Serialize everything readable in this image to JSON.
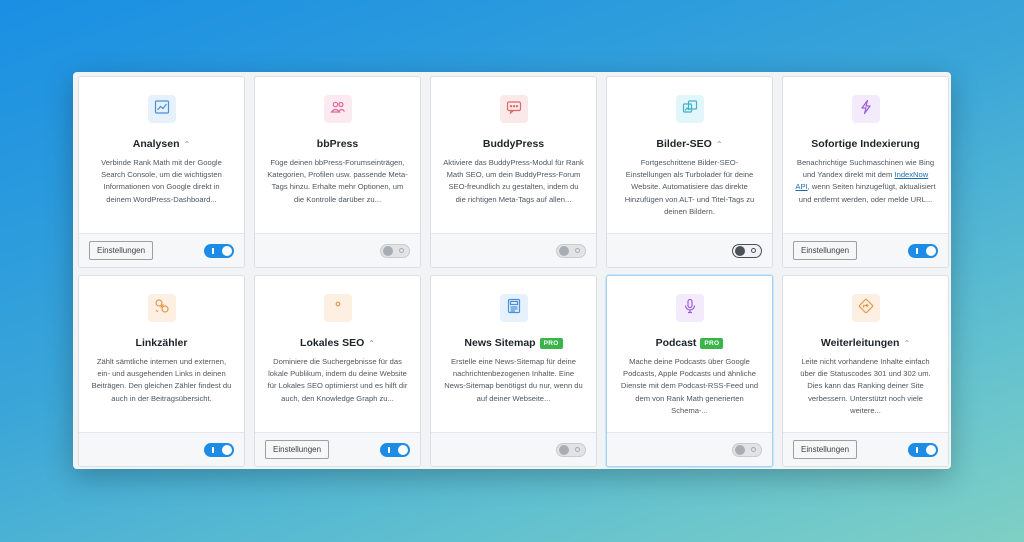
{
  "settings_label": "Einstellungen",
  "pro_label": "PRO",
  "modules": [
    {
      "title": "Analysen",
      "collapsible": true,
      "pro": false,
      "icon": "chart-icon",
      "icon_bg": "#e7f1fb",
      "icon_color": "#4a90d9",
      "desc_pre": "Verbinde Rank Math mit der Google Search Console, um die wichtigsten Informationen von Google direkt in deinem WordPress-Dashboard...",
      "link": "",
      "desc_post": "",
      "settings": true,
      "toggle": "on"
    },
    {
      "title": "bbPress",
      "collapsible": false,
      "pro": false,
      "icon": "users-icon",
      "icon_bg": "#fdeaf1",
      "icon_color": "#e0699c",
      "desc_pre": "Füge deinen bbPress-Forumseinträgen, Kategorien, Profilen usw. passende Meta-Tags hinzu. Erhalte mehr Optionen, um die Kontrolle darüber zu...",
      "link": "",
      "desc_post": "",
      "settings": false,
      "toggle": "off"
    },
    {
      "title": "BuddyPress",
      "collapsible": false,
      "pro": false,
      "icon": "chat-icon",
      "icon_bg": "#fbe9e9",
      "icon_color": "#d96a6a",
      "desc_pre": "Aktiviere das BuddyPress-Modul für Rank Math SEO, um dein BuddyPress-Forum SEO-freundlich zu gestalten, indem du die richtigen Meta-Tags auf allen...",
      "link": "",
      "desc_post": "",
      "settings": false,
      "toggle": "off"
    },
    {
      "title": "Bilder-SEO",
      "collapsible": true,
      "pro": false,
      "icon": "images-icon",
      "icon_bg": "#e3f6f9",
      "icon_color": "#3fb3c9",
      "desc_pre": "Fortgeschrittene Bilder-SEO-Einstellungen als Turbolader für deine Website. Automatisiere das direkte Hinzufügen von ALT- und Titel-Tags zu deinen Bildern.",
      "link": "",
      "desc_post": "",
      "settings": false,
      "toggle": "off-dark"
    },
    {
      "title": "Sofortige Indexierung",
      "collapsible": false,
      "pro": false,
      "icon": "bolt-icon",
      "icon_bg": "#f3eafc",
      "icon_color": "#9b5fd9",
      "desc_pre": "Benachrichtige Suchmaschinen wie Bing und Yandex direkt mit dem ",
      "link": "IndexNow API",
      "desc_post": ", wenn Seiten hinzugefügt, aktualisiert und entfernt werden, oder melde URL...",
      "settings": true,
      "toggle": "on"
    },
    {
      "title": "Linkzähler",
      "collapsible": false,
      "pro": false,
      "icon": "link-icon",
      "icon_bg": "#fdf0e3",
      "icon_color": "#e19a4c",
      "desc_pre": "Zählt sämtliche internen und externen, ein- und ausgehenden Links in deinen Beiträgen. Den gleichen Zähler findest du auch in der Beitragsübersicht.",
      "link": "",
      "desc_post": "",
      "settings": false,
      "toggle": "on"
    },
    {
      "title": "Lokales SEO",
      "collapsible": true,
      "pro": false,
      "icon": "location-pin-icon",
      "icon_bg": "#fdf0e3",
      "icon_color": "#e19a4c",
      "desc_pre": "Dominiere die Suchergebnisse für das lokale Publikum, indem du deine Website für Lokales SEO optimierst und es hilft dir auch, den Knowledge Graph zu...",
      "link": "",
      "desc_post": "",
      "settings": true,
      "toggle": "on"
    },
    {
      "title": "News Sitemap",
      "collapsible": false,
      "pro": true,
      "icon": "news-icon",
      "icon_bg": "#e7f1fb",
      "icon_color": "#4a90d9",
      "desc_pre": "Erstelle eine News-Sitemap für deine nachrichtenbezogenen Inhalte. Eine News-Sitemap benötigst du nur, wenn du auf deiner Webseite...",
      "link": "",
      "desc_post": "",
      "settings": false,
      "toggle": "off"
    },
    {
      "title": "Podcast",
      "collapsible": false,
      "pro": true,
      "icon": "microphone-icon",
      "icon_bg": "#f3eafc",
      "icon_color": "#9b5fd9",
      "desc_pre": "Mache deine Podcasts über Google Podcasts, Apple Podcasts und ähnliche Dienste mit dem Podcast-RSS-Feed und dem von Rank Math generierten Schema-...",
      "link": "",
      "desc_post": "",
      "settings": false,
      "toggle": "off"
    },
    {
      "title": "Weiterleitungen",
      "collapsible": true,
      "pro": false,
      "icon": "redirect-icon",
      "icon_bg": "#fdf0e3",
      "icon_color": "#e19a4c",
      "desc_pre": "Leite nicht vorhandene Inhalte einfach über die Statuscodes 301 und 302 um. Dies kann das Ranking deiner Site verbessern. Unterstützt noch viele weitere...",
      "link": "",
      "desc_post": "",
      "settings": true,
      "toggle": "on"
    }
  ]
}
